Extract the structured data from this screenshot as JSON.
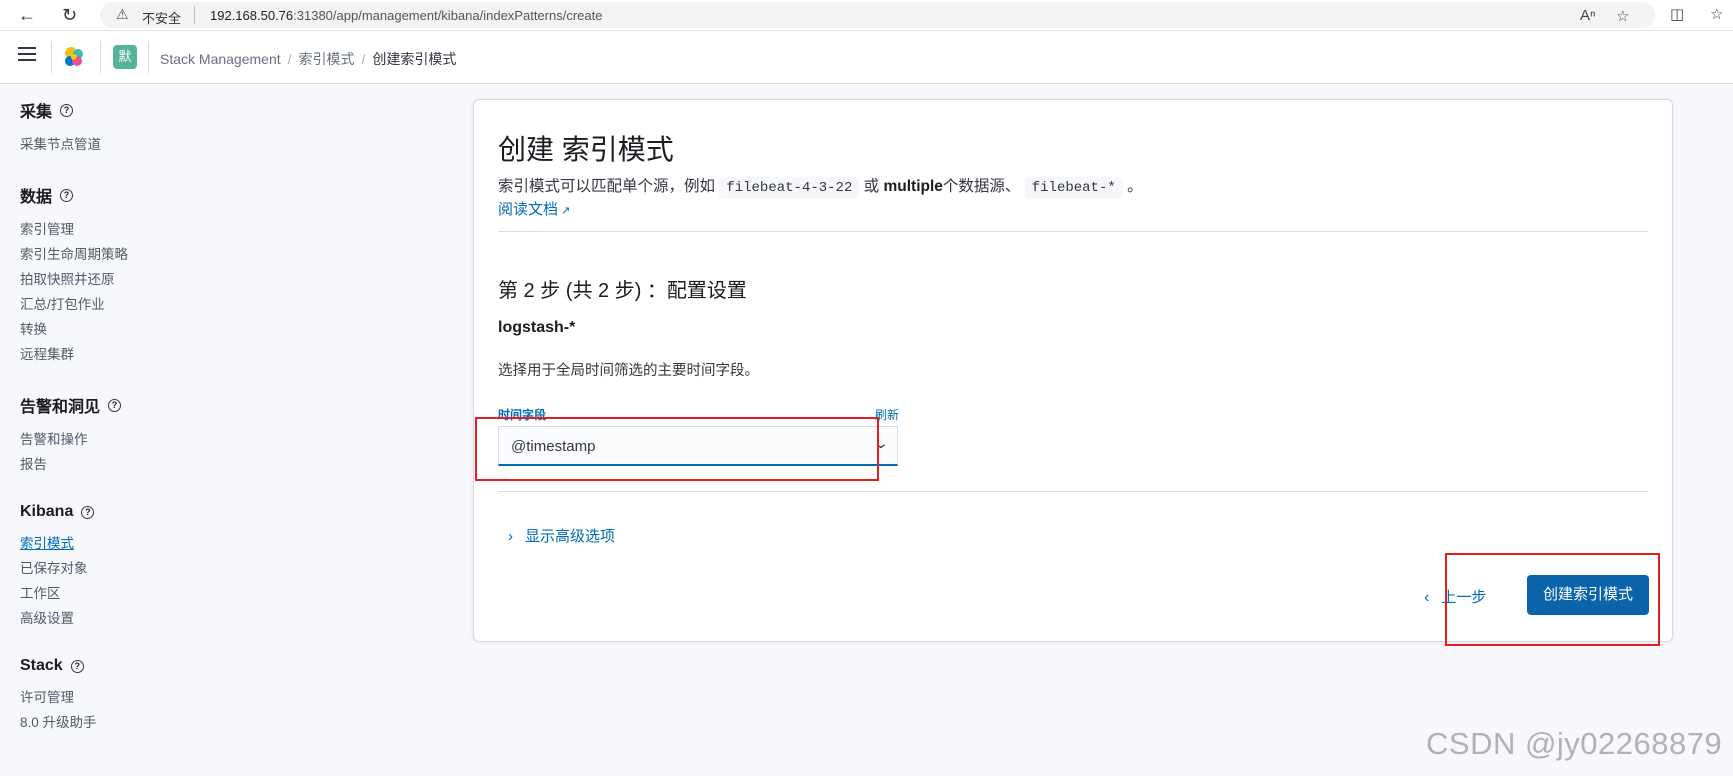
{
  "browser": {
    "insecure_label": "不安全",
    "url_host": "192.168.50.76",
    "url_rest": ":31380/app/management/kibana/indexPatterns/create"
  },
  "header": {
    "space_avatar": "默",
    "breadcrumbs": [
      "Stack Management",
      "索引模式",
      "创建索引模式"
    ]
  },
  "sidebar": {
    "groups": [
      {
        "title": "采集",
        "items": [
          "采集节点管道"
        ]
      },
      {
        "title": "数据",
        "items": [
          "索引管理",
          "索引生命周期策略",
          "拍取快照并还原",
          "汇总/打包作业",
          "转换",
          "远程集群"
        ]
      },
      {
        "title": "告警和洞见",
        "items": [
          "告警和操作",
          "报告"
        ]
      },
      {
        "title": "Kibana",
        "items": [
          "索引模式",
          "已保存对象",
          "工作区",
          "高级设置"
        ]
      },
      {
        "title": "Stack",
        "items": [
          "许可管理",
          "8.0 升级助手"
        ]
      }
    ]
  },
  "main": {
    "title": "创建 索引模式",
    "desc_part1": "索引模式可以匹配单个源，例如",
    "desc_code1": "filebeat-4-3-22",
    "desc_part2": "或",
    "desc_bold": "multiple",
    "desc_part3": "个数据源、",
    "desc_code2": "filebeat-*",
    "desc_part4": "。",
    "docs_link": "阅读文档",
    "step_title": "第 2 步 (共 2 步) ：配置设置",
    "pattern_name": "logstash-*",
    "field_hint": "选择用于全局时间筛选的主要时间字段。",
    "time_field_label": "时间字段",
    "refresh_label": "刷新",
    "time_field_value": "@timestamp",
    "advanced_toggle": "显示高级选项",
    "back_button": "上一步",
    "create_button": "创建索引模式"
  },
  "watermark": "CSDN @jy02268879",
  "colors": {
    "accent": "#006bb8",
    "primary_button": "#0b64aa",
    "highlight_box": "#e02020",
    "space_badge": "#54b399"
  }
}
